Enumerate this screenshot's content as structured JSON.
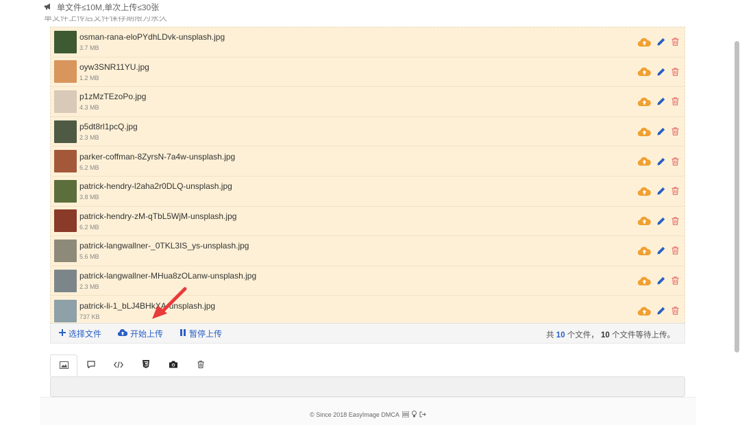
{
  "notice": {
    "line1": "单文件≤10M,单次上传≤30张",
    "line2": "单文件上传后文件保存期限为永久"
  },
  "files": [
    {
      "name": "osman-rana-eloPYdhLDvk-unsplash.jpg",
      "size": "3.7 MB",
      "thumb_color": "#3e5a32"
    },
    {
      "name": "oyw3SNR11YU.jpg",
      "size": "1.2 MB",
      "thumb_color": "#d8955c"
    },
    {
      "name": "p1zMzTEzoPo.jpg",
      "size": "4.3 MB",
      "thumb_color": "#d8c9b8"
    },
    {
      "name": "p5dt8rl1pcQ.jpg",
      "size": "2.3 MB",
      "thumb_color": "#4e5a44"
    },
    {
      "name": "parker-coffman-8ZyrsN-7a4w-unsplash.jpg",
      "size": "6.2 MB",
      "thumb_color": "#a4583a"
    },
    {
      "name": "patrick-hendry-l2aha2r0DLQ-unsplash.jpg",
      "size": "3.8 MB",
      "thumb_color": "#5c6e3c"
    },
    {
      "name": "patrick-hendry-zM-qTbL5WjM-unsplash.jpg",
      "size": "6.2 MB",
      "thumb_color": "#8a3a28"
    },
    {
      "name": "patrick-langwallner-_0TKL3IS_ys-unsplash.jpg",
      "size": "5.6 MB",
      "thumb_color": "#8e8a7a"
    },
    {
      "name": "patrick-langwallner-MHua8zOLanw-unsplash.jpg",
      "size": "2.3 MB",
      "thumb_color": "#7c868a"
    },
    {
      "name": "patrick-li-1_bLJ4BHkXA-unsplash.jpg",
      "size": "737 KB",
      "thumb_color": "#8ea0a8"
    }
  ],
  "toolbar": {
    "select_label": "选择文件",
    "start_label": "开始上传",
    "pause_label": "暂停上传",
    "stats_prefix": "共",
    "total_count": "10",
    "stats_mid": "个文件，",
    "pending_count": "10",
    "stats_suffix": "个文件等待上传。"
  },
  "tabs": [
    "image-icon",
    "comment-icon",
    "code-icon",
    "html5-icon",
    "camera-icon",
    "trash-icon"
  ],
  "footer": {
    "text": "© Since 2018 EasyImage DMCA"
  },
  "colors": {
    "accent": "#2a5fc4",
    "upload_icon": "#f0a030",
    "delete_icon": "#e06060",
    "row_bg": "#fdf0d6",
    "arrow": "#e83b3b"
  }
}
